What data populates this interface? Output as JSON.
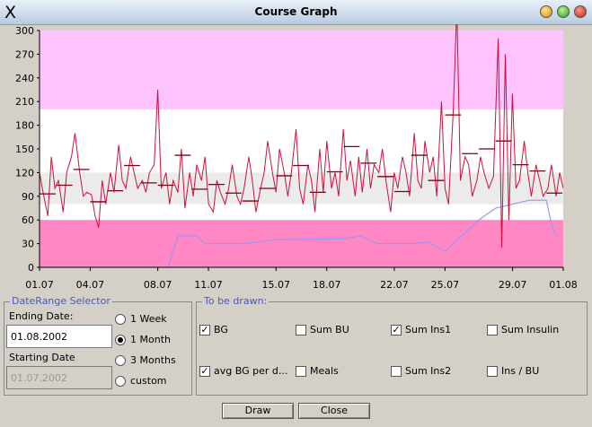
{
  "window": {
    "title": "Course Graph"
  },
  "chart_data": {
    "type": "line",
    "x_ticks": [
      "01.07",
      "04.07",
      "08.07",
      "11.07",
      "15.07",
      "18.07",
      "22.07",
      "25.07",
      "29.07",
      "01.08"
    ],
    "y_ticks": [
      "0",
      "30",
      "60",
      "90",
      "120",
      "150",
      "180",
      "210",
      "240",
      "270",
      "300"
    ],
    "ylim": [
      0,
      300
    ],
    "xlim": [
      0,
      31
    ],
    "bands": [
      {
        "from": 200,
        "to": 300,
        "color": "#ffc4ff"
      },
      {
        "from": 80,
        "to": 120,
        "color": "#ebebeb"
      },
      {
        "from": 0,
        "to": 60,
        "color": "#ff88c4"
      }
    ],
    "colors": {
      "bg": "#d0103a",
      "avg": "#7a0018",
      "ins": "#9898ee"
    },
    "series": [
      {
        "values": [
          [
            0,
            120
          ],
          [
            0.3,
            95
          ],
          [
            0.7,
            65
          ],
          [
            1,
            140
          ],
          [
            1.3,
            100
          ],
          [
            1.6,
            110
          ],
          [
            2,
            70
          ],
          [
            2.3,
            120
          ],
          [
            2.7,
            140
          ],
          [
            3,
            170
          ],
          [
            3.4,
            120
          ],
          [
            3.7,
            90
          ],
          [
            4,
            95
          ],
          [
            4.4,
            92
          ],
          [
            4.7,
            65
          ],
          [
            5,
            50
          ],
          [
            5.3,
            110
          ],
          [
            5.6,
            80
          ],
          [
            6,
            120
          ],
          [
            6.3,
            95
          ],
          [
            6.7,
            155
          ],
          [
            7,
            110
          ],
          [
            7.3,
            100
          ],
          [
            7.7,
            140
          ],
          [
            8,
            120
          ],
          [
            8.3,
            100
          ],
          [
            8.7,
            110
          ],
          [
            9,
            95
          ],
          [
            9.3,
            120
          ],
          [
            9.7,
            130
          ],
          [
            10,
            225
          ],
          [
            10.3,
            100
          ],
          [
            10.7,
            120
          ],
          [
            11,
            80
          ],
          [
            11.3,
            110
          ],
          [
            11.7,
            95
          ],
          [
            12,
            150
          ],
          [
            12.3,
            75
          ],
          [
            12.7,
            120
          ],
          [
            13,
            90
          ],
          [
            13.3,
            130
          ],
          [
            13.7,
            110
          ],
          [
            14,
            140
          ],
          [
            14.3,
            80
          ],
          [
            14.7,
            70
          ],
          [
            15,
            110
          ],
          [
            15.3,
            95
          ],
          [
            15.7,
            80
          ],
          [
            16,
            100
          ],
          [
            16.3,
            130
          ],
          [
            16.7,
            90
          ],
          [
            17,
            80
          ],
          [
            17.3,
            100
          ],
          [
            17.7,
            140
          ],
          [
            18,
            110
          ],
          [
            18.3,
            70
          ],
          [
            18.7,
            100
          ],
          [
            19,
            120
          ],
          [
            19.3,
            160
          ],
          [
            19.7,
            120
          ],
          [
            20,
            95
          ],
          [
            20.3,
            150
          ],
          [
            20.7,
            120
          ],
          [
            21,
            90
          ],
          [
            21.3,
            120
          ],
          [
            21.7,
            175
          ],
          [
            22,
            100
          ],
          [
            22.3,
            80
          ],
          [
            22.7,
            130
          ],
          [
            23,
            110
          ],
          [
            23.3,
            70
          ],
          [
            23.7,
            150
          ],
          [
            24,
            95
          ],
          [
            24.3,
            160
          ],
          [
            24.7,
            100
          ],
          [
            25,
            120
          ],
          [
            25.3,
            90
          ],
          [
            25.7,
            175
          ],
          [
            26,
            110
          ],
          [
            26.3,
            135
          ],
          [
            26.7,
            90
          ],
          [
            27,
            140
          ],
          [
            27.3,
            95
          ],
          [
            27.7,
            150
          ],
          [
            28,
            100
          ],
          [
            28.3,
            130
          ],
          [
            28.7,
            120
          ],
          [
            29,
            150
          ],
          [
            29.3,
            110
          ],
          [
            29.7,
            70
          ],
          [
            30,
            120
          ],
          [
            30.3,
            100
          ],
          [
            30.7,
            140
          ],
          [
            31,
            120
          ],
          [
            31.3,
            90
          ],
          [
            31.7,
            170
          ],
          [
            32,
            110
          ],
          [
            32.3,
            100
          ],
          [
            32.6,
            160
          ],
          [
            33,
            120
          ],
          [
            33.3,
            140
          ],
          [
            33.6,
            90
          ],
          [
            34,
            210
          ],
          [
            34.3,
            100
          ],
          [
            34.6,
            80
          ],
          [
            35,
            200
          ],
          [
            35.3,
            330
          ],
          [
            35.6,
            110
          ],
          [
            36,
            140
          ],
          [
            36.3,
            130
          ],
          [
            36.6,
            90
          ],
          [
            37,
            110
          ],
          [
            37.3,
            140
          ],
          [
            37.6,
            120
          ],
          [
            38,
            100
          ],
          [
            38.4,
            115
          ],
          [
            38.8,
            290
          ],
          [
            39.1,
            25
          ],
          [
            39.4,
            270
          ],
          [
            39.7,
            60
          ],
          [
            40,
            220
          ],
          [
            40.3,
            100
          ],
          [
            40.6,
            110
          ],
          [
            41,
            160
          ],
          [
            41.3,
            120
          ],
          [
            41.6,
            90
          ],
          [
            42,
            130
          ],
          [
            42.3,
            110
          ],
          [
            42.6,
            90
          ],
          [
            43,
            100
          ],
          [
            43.3,
            130
          ],
          [
            43.7,
            90
          ],
          [
            44,
            120
          ],
          [
            44.3,
            100
          ]
        ],
        "x_max": 44.3
      }
    ],
    "daily_averages": [
      [
        0,
        93
      ],
      [
        1,
        104
      ],
      [
        2,
        124
      ],
      [
        3,
        83
      ],
      [
        4,
        97
      ],
      [
        5,
        129
      ],
      [
        6,
        107
      ],
      [
        7,
        104
      ],
      [
        8,
        142
      ],
      [
        9,
        99
      ],
      [
        10,
        105
      ],
      [
        11,
        94
      ],
      [
        12,
        84
      ],
      [
        13,
        100
      ],
      [
        14,
        116
      ],
      [
        15,
        129
      ],
      [
        16,
        95
      ],
      [
        17,
        121
      ],
      [
        18,
        153
      ],
      [
        19,
        132
      ],
      [
        20,
        115
      ],
      [
        21,
        96
      ],
      [
        22,
        142
      ],
      [
        23,
        110
      ],
      [
        24,
        193
      ],
      [
        25,
        144
      ],
      [
        26,
        150
      ],
      [
        27,
        160
      ],
      [
        28,
        130
      ],
      [
        29,
        122
      ],
      [
        30,
        94
      ],
      [
        31,
        110
      ]
    ],
    "insulin_curve": [
      [
        7.6,
        0
      ],
      [
        8.2,
        40
      ],
      [
        9.3,
        40
      ],
      [
        9.8,
        30
      ],
      [
        12,
        30
      ],
      [
        13,
        32
      ],
      [
        14,
        35
      ],
      [
        18,
        36
      ],
      [
        19,
        40
      ],
      [
        20,
        30
      ],
      [
        22,
        30
      ],
      [
        23,
        32
      ],
      [
        24,
        20
      ],
      [
        25,
        40
      ],
      [
        26,
        60
      ],
      [
        27,
        75
      ],
      [
        28,
        80
      ],
      [
        29,
        85
      ],
      [
        30,
        85
      ],
      [
        30.3,
        55
      ],
      [
        30.6,
        40
      ]
    ]
  },
  "date_range": {
    "legend": "DateRange Selector",
    "ending_label": "Ending Date:",
    "ending_value": "01.08.2002",
    "starting_label": "Starting Date",
    "starting_value": "01.07.2002",
    "options": [
      {
        "label": "1 Week",
        "selected": false
      },
      {
        "label": "1 Month",
        "selected": true
      },
      {
        "label": "3 Months",
        "selected": false
      },
      {
        "label": "custom",
        "selected": false
      }
    ]
  },
  "to_draw": {
    "legend": "To be drawn:",
    "items": [
      {
        "label": "BG",
        "checked": true
      },
      {
        "label": "Sum BU",
        "checked": false
      },
      {
        "label": "Sum Ins1",
        "checked": true
      },
      {
        "label": "Sum Insulin",
        "checked": false
      },
      {
        "label": "avg BG per d...",
        "checked": true
      },
      {
        "label": "Meals",
        "checked": false
      },
      {
        "label": "Sum Ins2",
        "checked": false
      },
      {
        "label": "Ins / BU",
        "checked": false
      }
    ]
  },
  "buttons": {
    "draw": "Draw",
    "close": "Close"
  }
}
